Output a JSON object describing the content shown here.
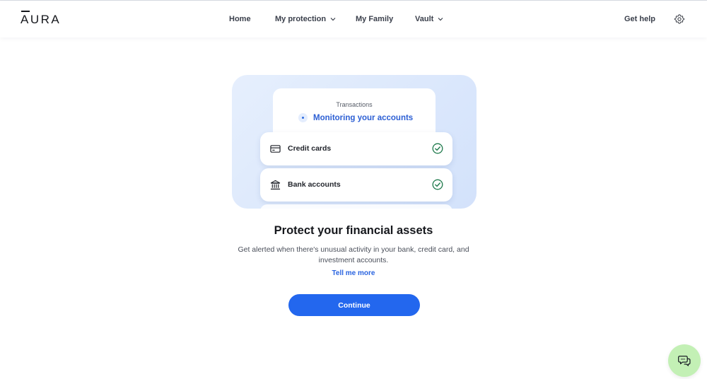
{
  "header": {
    "logo_prefix": "A",
    "logo_rest": "URA",
    "nav": [
      {
        "label": "Home"
      },
      {
        "label": "My protection"
      },
      {
        "label": "My Family"
      },
      {
        "label": "Vault"
      }
    ],
    "get_help": "Get help"
  },
  "illustration": {
    "card_label": "Transactions",
    "status": "Monitoring your accounts",
    "rows": [
      {
        "label": "Credit cards",
        "icon": "credit-card-icon",
        "checked": true
      },
      {
        "label": "Bank accounts",
        "icon": "bank-icon",
        "checked": true
      }
    ]
  },
  "content": {
    "title": "Protect your financial assets",
    "description": "Get alerted when there's unusual activity in your bank, credit card, and investment accounts.",
    "tell_more": "Tell me more",
    "continue": "Continue"
  },
  "icons": {
    "settings": "gear-icon",
    "chat": "chat-icon",
    "check": "check-circle-icon"
  },
  "colors": {
    "primary": "#2367ee",
    "link": "#2a64e0",
    "check_green": "#1f7a4c",
    "chat_bg": "#c3f0b5",
    "hero_bg": "#dce8fc"
  }
}
